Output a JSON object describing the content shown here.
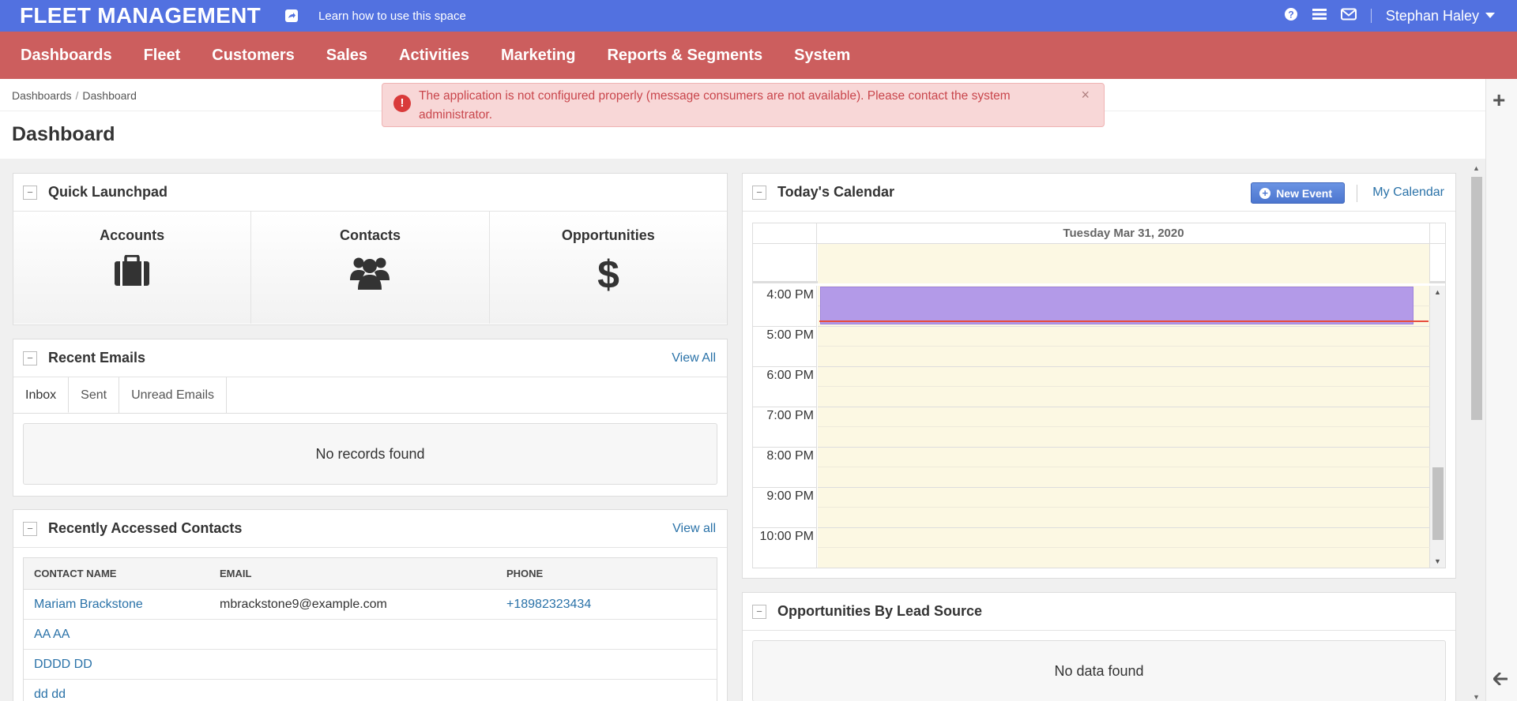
{
  "topbar": {
    "brand": "FLEET MANAGEMENT",
    "learn_link": "Learn how to use this space",
    "user_name": "Stephan Haley",
    "icons": [
      "share-icon",
      "help-icon",
      "menu-icon",
      "mail-icon",
      "caret-down-icon"
    ]
  },
  "colors": {
    "topbar_bg": "#5271e0",
    "nav_bg": "#cc5e5e",
    "alert_bg": "#f8d7d7",
    "alert_text": "#c9464c",
    "link": "#2a72a8",
    "event": "#b39ae8",
    "calendar_bg": "#fcf8e3"
  },
  "nav": {
    "items": [
      "Dashboards",
      "Fleet",
      "Customers",
      "Sales",
      "Activities",
      "Marketing",
      "Reports & Segments",
      "System"
    ]
  },
  "breadcrumb": {
    "items": [
      "Dashboards",
      "Dashboard"
    ],
    "separator": "/"
  },
  "alert": {
    "message": "The application is not configured properly (message consumers are not available). Please contact the system administrator.",
    "close": "×"
  },
  "page": {
    "title": "Dashboard"
  },
  "quick_launchpad": {
    "title": "Quick Launchpad",
    "items": [
      {
        "label": "Accounts",
        "icon": "briefcase-icon"
      },
      {
        "label": "Contacts",
        "icon": "users-icon"
      },
      {
        "label": "Opportunities",
        "icon": "dollar-icon"
      }
    ]
  },
  "recent_emails": {
    "title": "Recent Emails",
    "view_all": "View All",
    "tabs": [
      "Inbox",
      "Sent",
      "Unread Emails"
    ],
    "active_tab": "Inbox",
    "empty": "No records found"
  },
  "recent_contacts": {
    "title": "Recently Accessed Contacts",
    "view_all": "View all",
    "columns": [
      "CONTACT NAME",
      "EMAIL",
      "PHONE"
    ],
    "rows": [
      {
        "name": "Mariam Brackstone",
        "email": "mbrackstone9@example.com",
        "phone": "+18982323434"
      },
      {
        "name": "AA AA",
        "email": "",
        "phone": ""
      },
      {
        "name": "DDDD DD",
        "email": "",
        "phone": ""
      },
      {
        "name": "dd dd",
        "email": "",
        "phone": ""
      }
    ]
  },
  "calendar": {
    "title": "Today's Calendar",
    "new_event": "New Event",
    "my_calendar": "My Calendar",
    "day_header": "Tuesday Mar 31, 2020",
    "times": [
      "4:00 PM",
      "5:00 PM",
      "6:00 PM",
      "7:00 PM",
      "8:00 PM",
      "9:00 PM",
      "10:00 PM"
    ]
  },
  "opportunities_by_lead_source": {
    "title": "Opportunities By Lead Source",
    "empty": "No data found"
  },
  "collapse_symbol": "−"
}
